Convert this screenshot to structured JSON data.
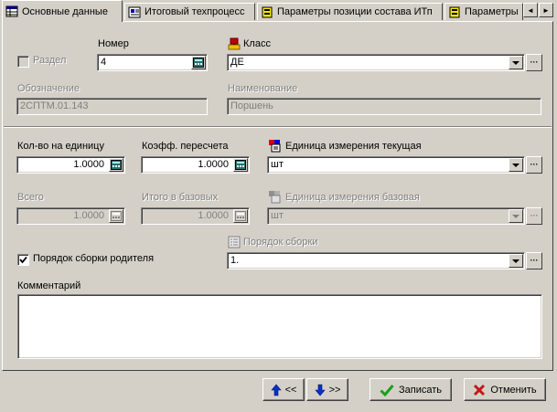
{
  "tabs": [
    {
      "label": "Основные данные",
      "icon": "table-icon",
      "active": true
    },
    {
      "label": "Итоговый техпроцесс",
      "icon": "techprocess-icon",
      "active": false
    },
    {
      "label": "Параметры позиции состава ИТп",
      "icon": "parameters-icon",
      "active": false
    },
    {
      "label": "Параметры",
      "icon": "parameters-icon",
      "active": false
    }
  ],
  "tab_scroll": {
    "left": "◄",
    "right": "►"
  },
  "fields": {
    "section_label": "Раздел",
    "number_label": "Номер",
    "number_value": "4",
    "class_label": "Класс",
    "class_value": "ДЕ",
    "designation_label": "Обозначение",
    "designation_value": "2СПТМ.01.143",
    "name_label": "Наименование",
    "name_value": "Поршень",
    "qty_label": "Кол-во на единицу",
    "qty_value": "1.0000",
    "coef_label": "Коэфф. пересчета",
    "coef_value": "1.0000",
    "unit_current_label": "Единица измерения текущая",
    "unit_current_value": "шт",
    "total_label": "Всего",
    "total_value": "1.0000",
    "base_total_label": "Итого в базовых",
    "base_total_value": "1.0000",
    "unit_base_label": "Единица измерения базовая",
    "unit_base_value": "шт",
    "parent_order_label": "Порядок сборки родителя",
    "parent_order_checked": true,
    "order_label": "Порядок сборки",
    "order_value": "1.",
    "comment_label": "Комментарий",
    "comment_value": ""
  },
  "ellipsis": "···",
  "buttons": {
    "prev_label": "<<",
    "next_label": ">>",
    "save_label": "Записать",
    "cancel_label": "Отменить"
  },
  "colors": {
    "face": "#d4d0c8",
    "disabled_text": "#808080",
    "save_check": "#18a018",
    "cancel_x": "#c01818",
    "arrow_blue": "#0830c8"
  }
}
